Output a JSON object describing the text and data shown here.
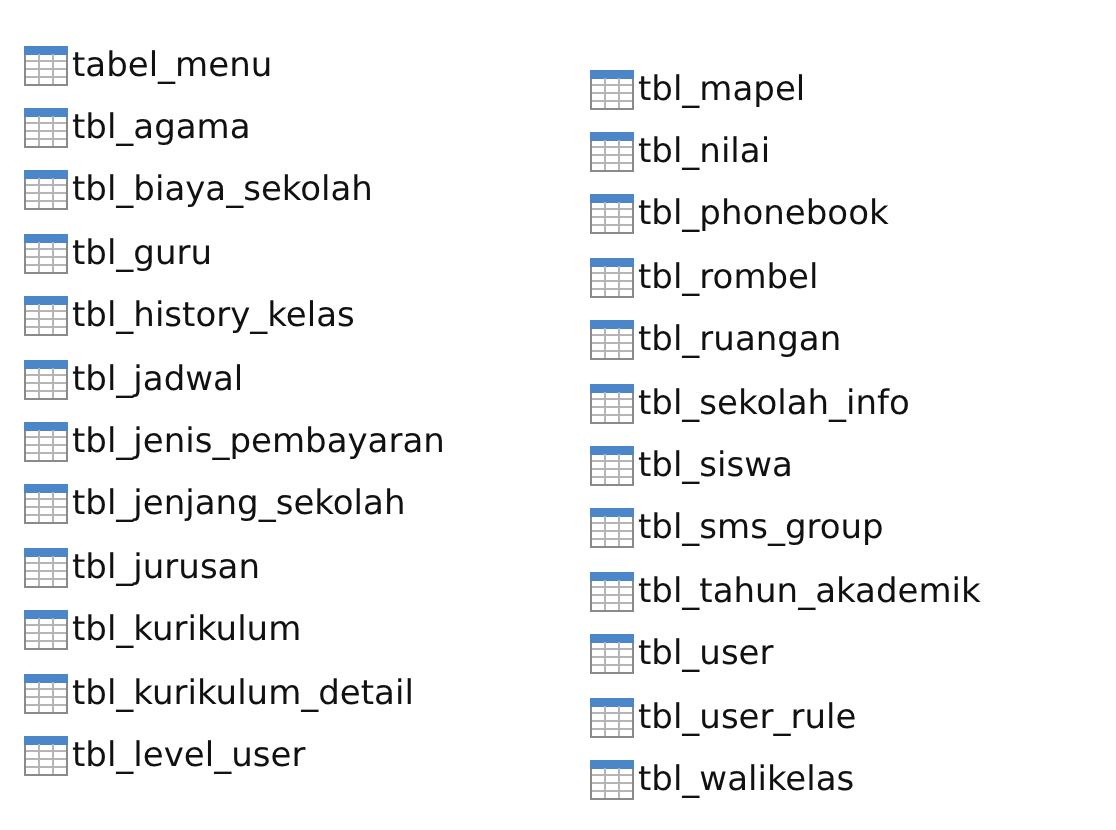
{
  "columns": [
    {
      "items": [
        "tabel_menu",
        "tbl_agama",
        "tbl_biaya_sekolah",
        "tbl_guru",
        "tbl_history_kelas",
        "tbl_jadwal",
        "tbl_jenis_pembayaran",
        "tbl_jenjang_sekolah",
        "tbl_jurusan",
        "tbl_kurikulum",
        "tbl_kurikulum_detail",
        "tbl_level_user"
      ]
    },
    {
      "items": [
        "tbl_mapel",
        "tbl_nilai",
        "tbl_phonebook",
        "tbl_rombel",
        "tbl_ruangan",
        "tbl_sekolah_info",
        "tbl_siswa",
        "tbl_sms_group",
        "tbl_tahun_akademik",
        "tbl_user",
        "tbl_user_rule",
        "tbl_walikelas"
      ]
    }
  ]
}
